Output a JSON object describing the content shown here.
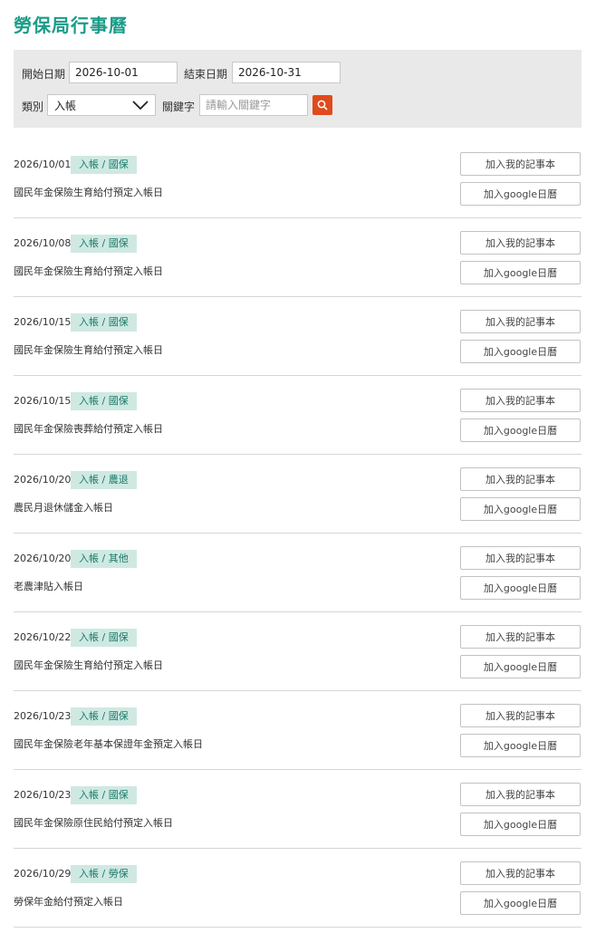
{
  "page": {
    "title": "勞保局行事曆"
  },
  "filter": {
    "start_label": "開始日期",
    "start_value": "2026-10-01",
    "end_label": "結束日期",
    "end_value": "2026-10-31",
    "category_label": "類別",
    "category_value": "入帳",
    "keyword_label": "關鍵字",
    "keyword_placeholder": "請輸入關鍵字"
  },
  "buttons": {
    "add_note": "加入我的記事本",
    "add_google": "加入google日曆"
  },
  "events": [
    {
      "date": "2026/10/01",
      "tag": "入帳 / 國保",
      "name": "國民年金保險生育給付預定入帳日"
    },
    {
      "date": "2026/10/08",
      "tag": "入帳 / 國保",
      "name": "國民年金保險生育給付預定入帳日"
    },
    {
      "date": "2026/10/15",
      "tag": "入帳 / 國保",
      "name": "國民年金保險生育給付預定入帳日"
    },
    {
      "date": "2026/10/15",
      "tag": "入帳 / 國保",
      "name": "國民年金保險喪葬給付預定入帳日"
    },
    {
      "date": "2026/10/20",
      "tag": "入帳 / 農退",
      "name": "農民月退休儲金入帳日"
    },
    {
      "date": "2026/10/20",
      "tag": "入帳 / 其他",
      "name": "老農津貼入帳日"
    },
    {
      "date": "2026/10/22",
      "tag": "入帳 / 國保",
      "name": "國民年金保險生育給付預定入帳日"
    },
    {
      "date": "2026/10/23",
      "tag": "入帳 / 國保",
      "name": "國民年金保險老年基本保證年金預定入帳日"
    },
    {
      "date": "2026/10/23",
      "tag": "入帳 / 國保",
      "name": "國民年金保險原住民給付預定入帳日"
    },
    {
      "date": "2026/10/29",
      "tag": "入帳 / 勞保",
      "name": "勞保年金給付預定入帳日"
    }
  ]
}
